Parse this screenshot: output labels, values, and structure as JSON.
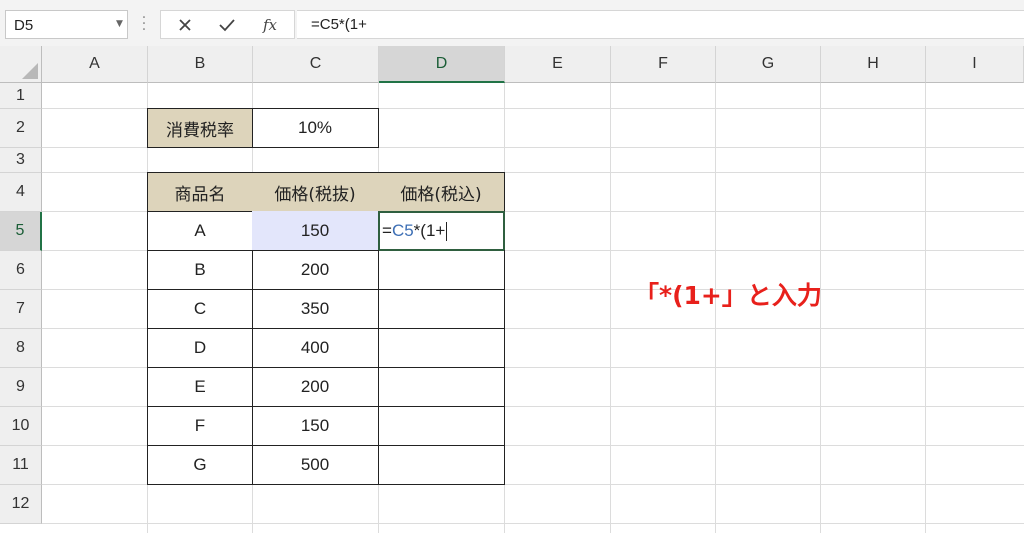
{
  "formula_bar": {
    "name_box": "D5",
    "formula": "=C5*(1+"
  },
  "columns": [
    "A",
    "B",
    "C",
    "D",
    "E",
    "F",
    "G",
    "H",
    "I"
  ],
  "active_column": "D",
  "rows": [
    "1",
    "2",
    "3",
    "4",
    "5",
    "6",
    "7",
    "8",
    "9",
    "10",
    "11",
    "12"
  ],
  "active_row": "5",
  "cells": {
    "tax_label": "消費税率",
    "tax_value": "10%",
    "headers": [
      "商品名",
      "価格(税抜)",
      "価格(税込)"
    ],
    "table": [
      {
        "name": "A",
        "price": "150"
      },
      {
        "name": "B",
        "price": "200"
      },
      {
        "name": "C",
        "price": "350"
      },
      {
        "name": "D",
        "price": "400"
      },
      {
        "name": "E",
        "price": "200"
      },
      {
        "name": "F",
        "price": "150"
      },
      {
        "name": "G",
        "price": "500"
      }
    ],
    "editing": {
      "prefix": "=",
      "ref": "C5",
      "suffix": "*(1+"
    }
  },
  "annotation": "「*(1+」と入力",
  "colors": {
    "annotation": "#e8201b",
    "header_fill": "#ddd4bb",
    "selection": "#e3e6fb",
    "reference": "#3d6fb5"
  }
}
